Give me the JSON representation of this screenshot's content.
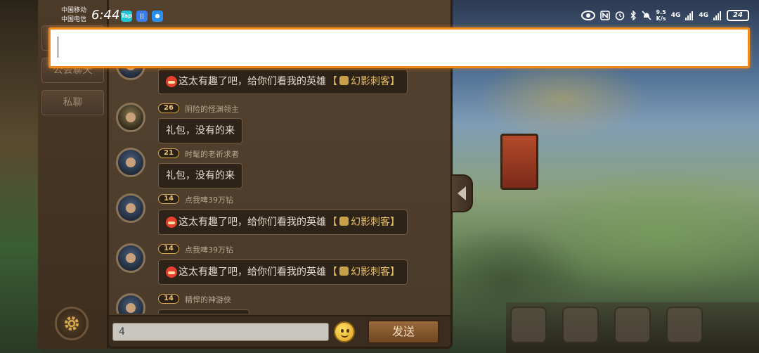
{
  "status_bar": {
    "carrier_1": "中国移动",
    "carrier_2": "中国电信",
    "time": "6:44",
    "apps": [
      {
        "icon": "taptap-icon",
        "label": "Tap",
        "color": "#1fc4d6"
      },
      {
        "icon": "app-icon",
        "label": "||",
        "color": "#3a7bf0"
      },
      {
        "icon": "browser-icon",
        "label": "●",
        "color": "#2a8ff0"
      }
    ],
    "net_speed_value": "9.5",
    "net_speed_unit": "K/s",
    "network_1": "4G",
    "network_2": "4G",
    "battery": "24"
  },
  "sidebar": {
    "tabs": [
      {
        "label": ""
      },
      {
        "label": "公会聊天"
      },
      {
        "label": "私聊"
      }
    ]
  },
  "messages": [
    {
      "level": "26",
      "name": "阴险的怪渊领主",
      "text": "礼包，没有的来",
      "share": false
    },
    {
      "level": "21",
      "name": "时髦的老祈求者",
      "text": "礼包，没有的来",
      "share": false
    },
    {
      "level": "14",
      "name": "点我啤39万钻",
      "text": "这太有趣了吧，给你们看我的英雄",
      "hero": "幻影刺客",
      "share": true
    },
    {
      "level": "14",
      "name": "点我啤39万钻",
      "text": "这太有趣了吧，给你们看我的英雄",
      "hero": "幻影刺客",
      "share": true
    },
    {
      "level": "14",
      "name": "精悍的神游侠",
      "text": "",
      "share": false
    }
  ],
  "partial_top_message": {
    "text": "这太有趣了吧，给你们看我的英雄",
    "hero": "幻影刺客"
  },
  "input": {
    "value": "4",
    "send_label": "发送"
  },
  "ime": {
    "value": ""
  },
  "colors": {
    "accent_focus": "#f08a1c",
    "level_badge": "#d4a84a",
    "hero_link": "#e8c060"
  }
}
